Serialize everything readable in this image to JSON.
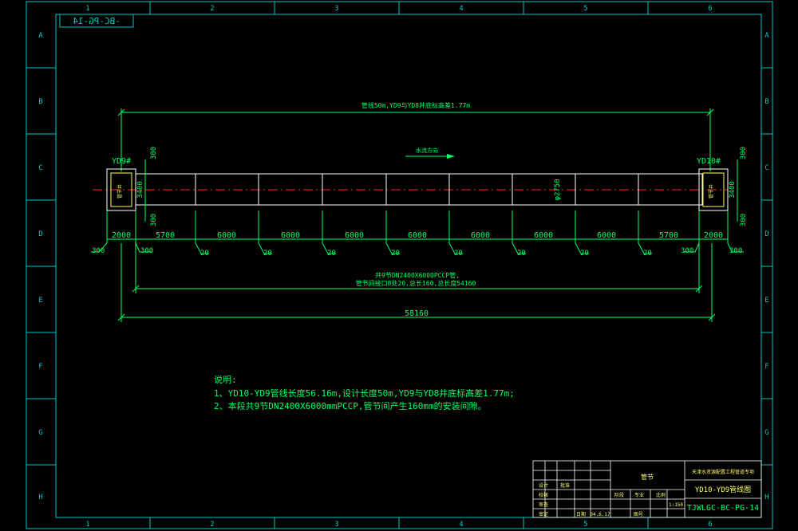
{
  "colors": {
    "background": "#000000",
    "border": "#00c8c8",
    "pipe": "#ffffff",
    "dimension": "#00ff66",
    "centerline": "#ff2020",
    "text": "#00ff66",
    "well": "#ffff66"
  },
  "frame": {
    "columns": [
      "1",
      "2",
      "3",
      "4",
      "5",
      "6"
    ],
    "rows": [
      "A",
      "B",
      "C",
      "D",
      "E",
      "F",
      "G",
      "H"
    ],
    "drawing_no_mirrored": "-BC-PG-14"
  },
  "plan": {
    "top_dimension_text": "管线50m,YD9与YD8井底标高差1.77m",
    "flow_label": "水流方向",
    "left_well": "YD9#",
    "right_well": "YD10#",
    "well_width": "3400",
    "offset_300": "300",
    "diameter": "φ2750",
    "well_inner_label": "管节井",
    "segments": [
      "2000",
      "5700",
      "6000",
      "6000",
      "6000",
      "6000",
      "6000",
      "6000",
      "6000",
      "5700",
      "2000"
    ],
    "joint_gap": "20",
    "pipe_summary_line1": "共9节DN2400X6000PCCP管,",
    "pipe_summary_line2": "管节间接口8处20,总长160,总长度54160",
    "total_length": "58160"
  },
  "notes": {
    "title": "说明:",
    "line1": "1、YD10-YD9管线长度56.16m,设计长度50m,YD9与YD8井底标高差1.77m;",
    "line2": "2、本段共9节DN2400X6000mmPCCP,管节间产生160mm的安装间隙。"
  },
  "title_block": {
    "project": "天津水资源配置工程管道专项",
    "sheet_title": "YD10-YD9管线图",
    "drawing_number": "TJWLGC-BC-PG-14",
    "stamp": "管节",
    "scale": "1:150",
    "date": "04.6.17",
    "labels": [
      "设计",
      "校核",
      "审查",
      "审定",
      "批准",
      "比例",
      "日期",
      "图号",
      "阶段",
      "专业"
    ]
  }
}
